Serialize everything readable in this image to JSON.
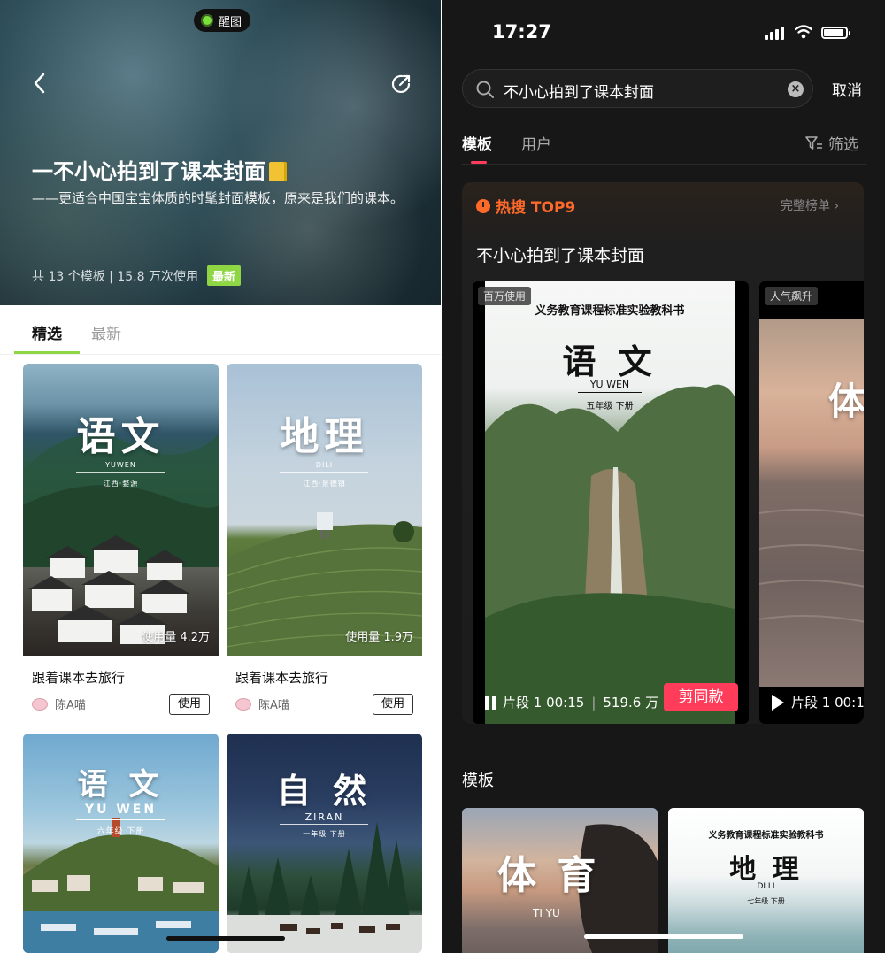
{
  "left": {
    "hero": {
      "pill_label": "醒图",
      "title": "一不小心拍到了课本封面",
      "subtitle": "——更适合中国宝宝体质的时髦封面模板，原来是我们的课本。",
      "stats": "共 13 个模板 | 15.8 万次使用",
      "badge": "最新"
    },
    "tabs": [
      "精选",
      "最新"
    ],
    "cards": [
      {
        "cover_title": "语文",
        "cover_pinyin": "YUWEN",
        "cover_place": "江西·婺源",
        "usage": "使用量 4.2万",
        "title": "跟着课本去旅行",
        "author": "陈A喵",
        "button": "使用"
      },
      {
        "cover_title": "地理",
        "cover_pinyin": "DILI",
        "cover_place": "江西·景德镇",
        "usage": "使用量 1.9万",
        "title": "跟着课本去旅行",
        "author": "陈A喵",
        "button": "使用"
      },
      {
        "cover_title": "语 文",
        "cover_pinyin": "YU WEN",
        "cover_place": "六年级 下册"
      },
      {
        "cover_title": "自 然",
        "cover_pinyin": "ZIRAN",
        "cover_place": "一年级 下册"
      }
    ]
  },
  "right": {
    "status": {
      "time": "17:27"
    },
    "search": {
      "query": "不小心拍到了课本封面",
      "cancel": "取消"
    },
    "tabs": [
      "模板",
      "用户"
    ],
    "filter": "筛选",
    "hot": {
      "label": "热搜 TOP9",
      "full_list": "完整榜单 ›",
      "query": "不小心拍到了课本封面",
      "videos": [
        {
          "tag": "百万使用",
          "book": "义务教育课程标准实验教科书",
          "cover_title": "语 文",
          "pinyin": "YU WEN",
          "grade": "五年级 下册",
          "segment": "片段 1 00:15",
          "plays": "519.6 万",
          "button": "剪同款"
        },
        {
          "tag": "人气飙升",
          "cover_title": "体",
          "segment": "片段 1 00:1"
        }
      ]
    },
    "section_title": "模板",
    "tiles": [
      {
        "cover_title": "体 育",
        "pinyin": "TI YU"
      },
      {
        "book": "义务教育课程标准实验教科书",
        "cover_title": "地 理",
        "pinyin": "DI LI",
        "grade": "七年级 下册"
      }
    ]
  },
  "colors": {
    "accent_green": "#8fd645",
    "accent_red": "#ff3d5a",
    "hot_orange": "#ff6a2b"
  }
}
